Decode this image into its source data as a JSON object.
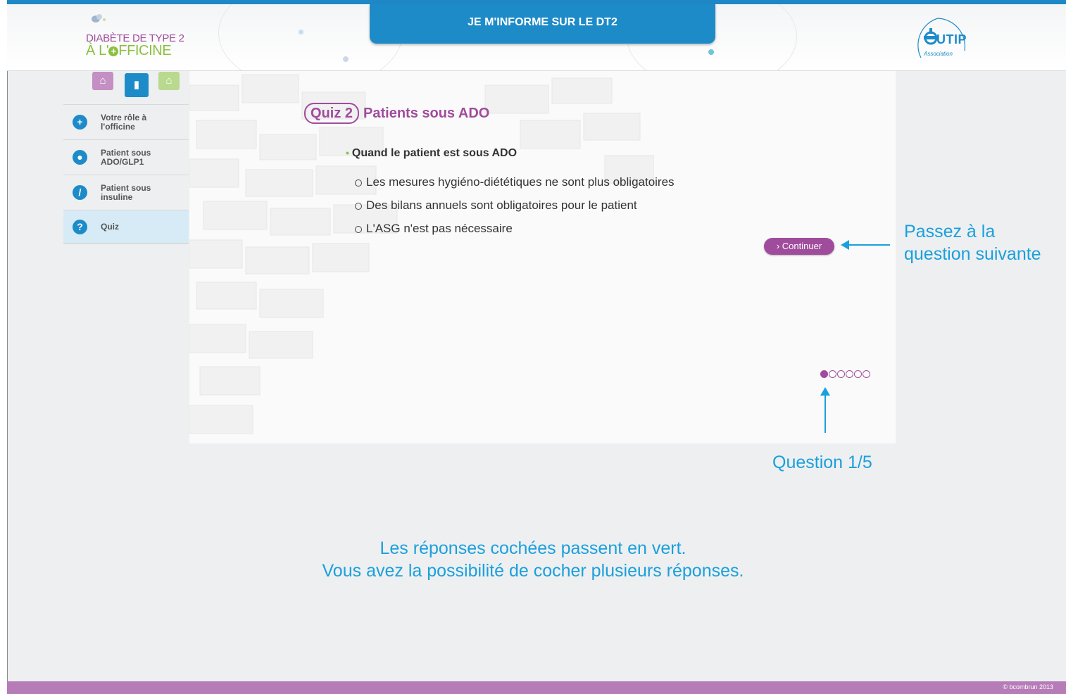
{
  "header": {
    "logo_line1": "DIABÈTE DE TYPE 2",
    "logo_line2_prefix": "À L'",
    "logo_line2_suffix": "FFICINE",
    "title": "JE M'INFORME SUR LE DT2",
    "partner_name": "UTIP",
    "partner_subtitle": "Association"
  },
  "nav_icons": [
    {
      "name": "home-icon",
      "color": "#c48fc3"
    },
    {
      "name": "book-icon",
      "color": "#1e8bc9"
    },
    {
      "name": "pharmacy-icon",
      "color": "#b9d98e"
    }
  ],
  "sidebar": {
    "items": [
      {
        "label": "Votre rôle à l'officine",
        "icon": "plus-icon",
        "active": false
      },
      {
        "label": "Patient sous ADO/GLP1",
        "icon": "pill-icon",
        "active": false
      },
      {
        "label": "Patient sous insuline",
        "icon": "syringe-icon",
        "active": false
      },
      {
        "label": "Quiz",
        "icon": "question-icon",
        "active": true
      }
    ]
  },
  "quiz": {
    "badge": "Quiz 2",
    "heading": "Patients sous ADO",
    "question": "Quand le patient est sous ADO",
    "answers": [
      "Les mesures hygiéno-diététiques ne sont plus obligatoires",
      "Des bilans annuels sont obligatoires pour le patient",
      "L'ASG n'est pas nécessaire"
    ],
    "continue_label": "Continuer",
    "progress": {
      "current": 1,
      "total_dots": 6
    }
  },
  "annotations": {
    "next_line1": "Passez à la",
    "next_line2": "question suivante",
    "question_counter": "Question 1/5",
    "info_line1": "Les réponses cochées passent en vert.",
    "info_line2": "Vous avez la possibilité de cocher plusieurs réponses."
  },
  "footer": {
    "copyright": "© bcombrun 2013"
  },
  "colors": {
    "accent_blue": "#1e8bc9",
    "accent_purple": "#a04c9c",
    "accent_green": "#8cbf3f",
    "annotation_blue": "#1aa0dc"
  }
}
